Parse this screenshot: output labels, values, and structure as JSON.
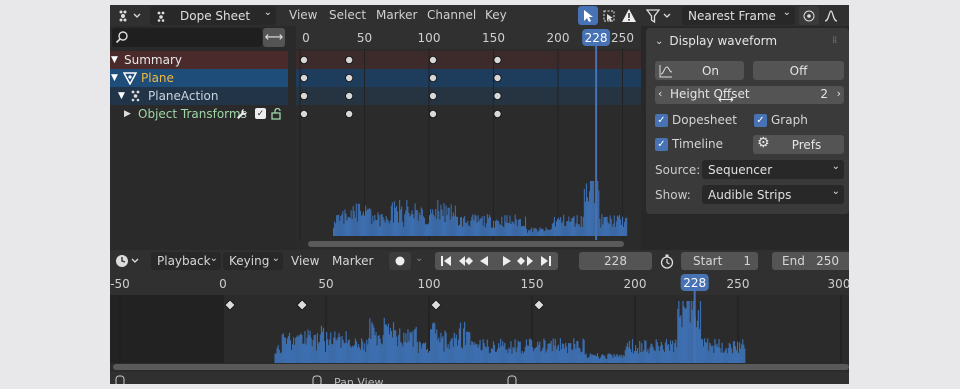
{
  "header": {
    "editor_mode": "Dope Sheet",
    "menus": [
      "View",
      "Select",
      "Marker",
      "Channel",
      "Key"
    ],
    "snap_mode": "Nearest Frame"
  },
  "search": {
    "placeholder": ""
  },
  "channels": {
    "summary": "Summary",
    "plane": "Plane",
    "action": "PlaneAction",
    "transforms": "Object Transforms"
  },
  "dopesheet": {
    "ruler_ticks": [
      "0",
      "50",
      "100",
      "150",
      "200",
      "250"
    ],
    "current_frame": "228",
    "keyframes": [
      0,
      35,
      100,
      150
    ]
  },
  "sidebar": {
    "title": "Display waveform",
    "on_label": "On",
    "off_label": "Off",
    "height_offset_label": "Height Offset",
    "height_offset_value": "2",
    "dopesheet_label": "Dopesheet",
    "graph_label": "Graph",
    "timeline_label": "Timeline",
    "prefs_label": "Prefs",
    "source_label": "Source:",
    "source_value": "Sequencer",
    "show_label": "Show:",
    "show_value": "Audible Strips"
  },
  "timeline": {
    "playback_label": "Playback",
    "keying_label": "Keying",
    "view_label": "View",
    "marker_label": "Marker",
    "current_frame": "228",
    "start_label": "Start",
    "start_value": "1",
    "end_label": "End",
    "end_value": "250",
    "ruler_ticks": [
      "-50",
      "0",
      "50",
      "100",
      "150",
      "200",
      "250",
      "300"
    ],
    "keyframes": [
      0,
      35,
      100,
      150
    ]
  },
  "footer": {
    "pan_view": "Pan View"
  },
  "colors": {
    "accent": "#4772b3",
    "waveform": "#3d6fb0",
    "summary_row": "#4a2a2a",
    "plane_row": "#1f4d7a"
  }
}
